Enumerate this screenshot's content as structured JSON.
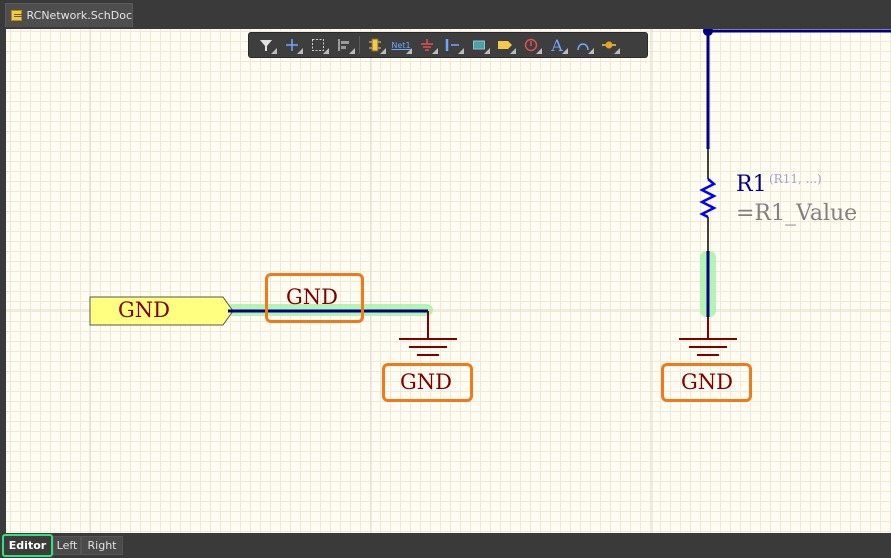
{
  "document_tab": {
    "label": "RCNetwork.SchDoc",
    "icon": "schematic-doc-icon"
  },
  "toolbar": {
    "buttons": [
      {
        "name": "filter",
        "icon": "filter-icon"
      },
      {
        "name": "move",
        "icon": "crosshair-icon"
      },
      {
        "name": "select",
        "icon": "select-rect-icon"
      },
      {
        "name": "align",
        "icon": "align-icon"
      },
      {
        "name": "place-part",
        "icon": "component-icon"
      },
      {
        "name": "net-label",
        "icon": "net-label-icon",
        "text": "Net1"
      },
      {
        "name": "power-port",
        "icon": "ground-icon"
      },
      {
        "name": "bus",
        "icon": "bus-icon"
      },
      {
        "name": "harness",
        "icon": "harness-icon"
      },
      {
        "name": "port",
        "icon": "port-icon",
        "text": "D1"
      },
      {
        "name": "directive",
        "icon": "directive-icon"
      },
      {
        "name": "text",
        "icon": "text-icon",
        "text": "A"
      },
      {
        "name": "arc",
        "icon": "arc-icon"
      },
      {
        "name": "junction",
        "icon": "junction-icon"
      }
    ]
  },
  "schematic": {
    "port_label": "GND",
    "net_label": "GND",
    "ground_left_label": "GND",
    "ground_right_label": "GND",
    "resistor": {
      "designator": "R1",
      "designator_alt": "(R11, ...)",
      "value": "=R1_Value"
    }
  },
  "bottom_tabs": [
    {
      "label": "Editor",
      "active": true
    },
    {
      "label": "Left",
      "active": false
    },
    {
      "label": "Right",
      "active": false
    }
  ],
  "colors": {
    "wire": "#000080",
    "ground_symbol": "#800000",
    "port_fill": "#ffff80",
    "highlight": "#f07a1a",
    "selection": "#a9f2a9",
    "grid_major": "#e2dccd"
  }
}
